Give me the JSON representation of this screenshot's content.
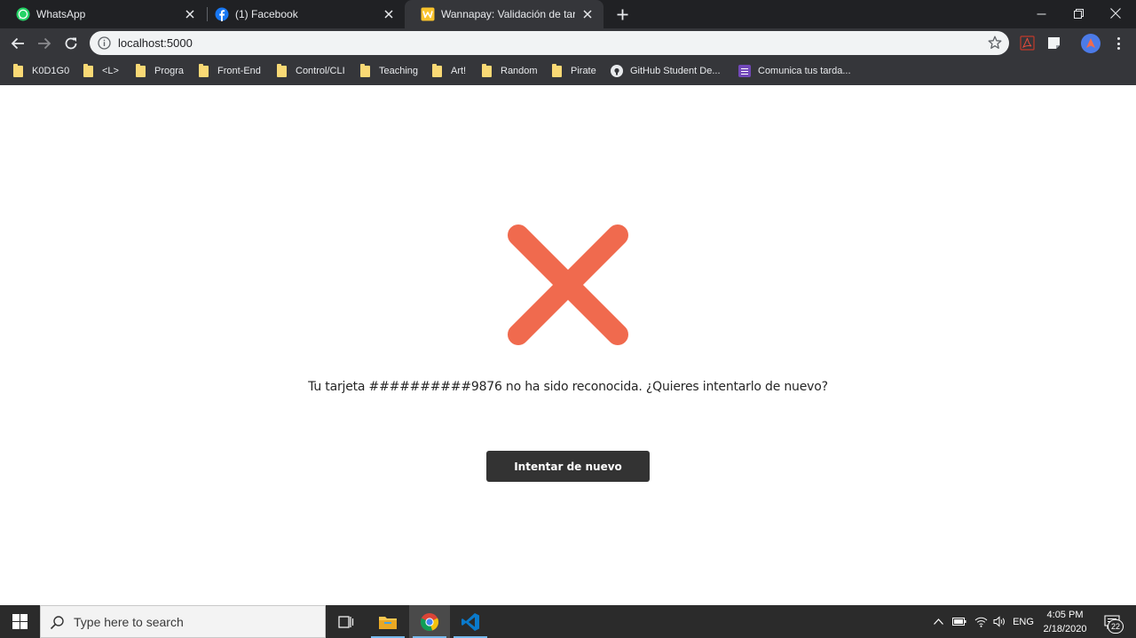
{
  "browser": {
    "tabs": [
      {
        "title": "WhatsApp",
        "icon": "whatsapp-icon",
        "active": false
      },
      {
        "title": "(1) Facebook",
        "icon": "facebook-icon",
        "active": false
      },
      {
        "title": "Wannapay: Validación de tarjetas",
        "icon": "wannapay-icon",
        "active": true
      }
    ],
    "address": {
      "url": "localhost:5000"
    },
    "bookmarks": [
      {
        "label": "K0D1G0",
        "icon": "folder-icon"
      },
      {
        "label": "<L>",
        "icon": "folder-icon"
      },
      {
        "label": "Progra",
        "icon": "folder-icon"
      },
      {
        "label": "Front-End",
        "icon": "folder-icon"
      },
      {
        "label": "Control/CLI",
        "icon": "folder-icon"
      },
      {
        "label": "Teaching",
        "icon": "folder-icon"
      },
      {
        "label": "Art!",
        "icon": "folder-icon"
      },
      {
        "label": "Random",
        "icon": "folder-icon"
      },
      {
        "label": "Pirate",
        "icon": "folder-icon"
      },
      {
        "label": "GitHub Student De...",
        "icon": "github-icon"
      },
      {
        "label": "Comunica tus tarda...",
        "icon": "forms-icon"
      }
    ]
  },
  "page": {
    "message": "Tu tarjeta ##########9876 no ha sido reconocida. ¿Quieres intentarlo de nuevo?",
    "retry_label": "Intentar de nuevo",
    "error_color": "#f06a4e"
  },
  "taskbar": {
    "search_placeholder": "Type here to search",
    "language": "ENG",
    "time": "4:05 PM",
    "date": "2/18/2020",
    "notification_count": "22"
  }
}
